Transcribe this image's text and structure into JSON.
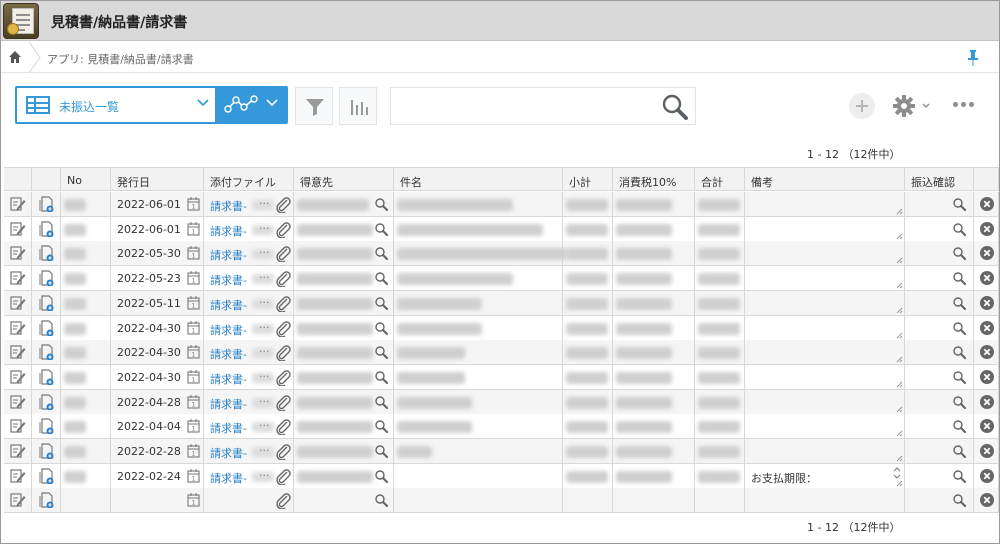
{
  "app": {
    "title": "見積書/納品書/請求書"
  },
  "breadcrumb": {
    "text": "アプリ: 見積書/納品書/請求書"
  },
  "toolbar": {
    "view_label": "未振込一覧",
    "search_placeholder": ""
  },
  "pager": {
    "text": "1 - 12 （12件中）"
  },
  "table": {
    "columns": [
      "No",
      "発行日",
      "添付ファイル",
      "得意先",
      "件名",
      "小計",
      "消費税10%",
      "合計",
      "備考",
      "振込確認"
    ],
    "file_prefix": "請求書-",
    "file_dots": "···",
    "rows": [
      {
        "date": "2022-06-01"
      },
      {
        "date": "2022-06-01"
      },
      {
        "date": "2022-05-30"
      },
      {
        "date": "2022-05-23"
      },
      {
        "date": "2022-05-11"
      },
      {
        "date": "2022-04-30"
      },
      {
        "date": "2022-04-30"
      },
      {
        "date": "2022-04-30"
      },
      {
        "date": "2022-04-28"
      },
      {
        "date": "2022-04-04"
      },
      {
        "date": "2022-02-28"
      },
      {
        "date": "2022-02-24",
        "memo": "お支払期限："
      }
    ]
  },
  "colors": {
    "accent": "#3498db",
    "link": "#2a7fc9",
    "header_bg": "#d9d9d9"
  }
}
